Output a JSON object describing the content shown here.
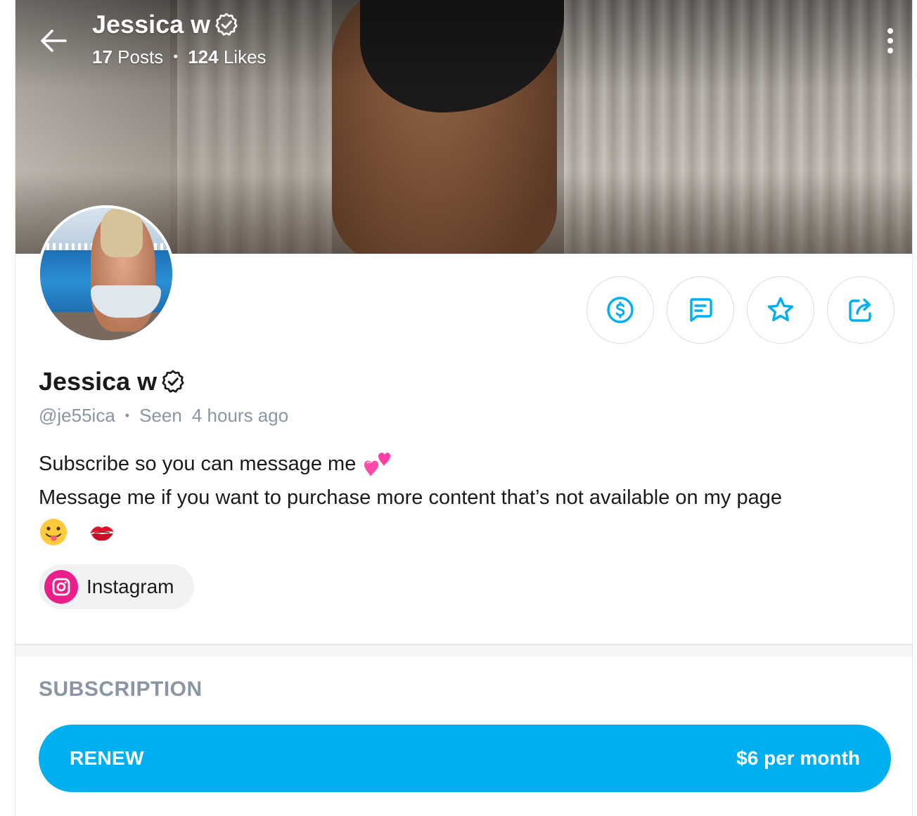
{
  "header": {
    "name": "Jessica w",
    "posts_count": "17",
    "posts_label": "Posts",
    "likes_count": "124",
    "likes_label": "Likes",
    "separator": "•"
  },
  "profile": {
    "name": "Jessica w",
    "username": "@je55ica",
    "separator": "•",
    "seen_label": "Seen",
    "seen_time": "4 hours ago",
    "verified": true,
    "bio_line1": "Subscribe so you can message me",
    "bio_line2": "Message me if you want to purchase more content that’s not available on my page"
  },
  "actions": [
    {
      "icon": "dollar-icon",
      "name": "tip-button"
    },
    {
      "icon": "message-icon",
      "name": "message-button"
    },
    {
      "icon": "star-icon",
      "name": "favorite-button"
    },
    {
      "icon": "share-icon",
      "name": "share-button"
    }
  ],
  "social": {
    "instagram_label": "Instagram"
  },
  "subscription": {
    "title": "SUBSCRIPTION",
    "renew_label": "RENEW",
    "price": "$6 per month"
  },
  "colors": {
    "accent": "#00aff0",
    "muted": "#8a96a3",
    "instagram": "#ea1f8b"
  }
}
